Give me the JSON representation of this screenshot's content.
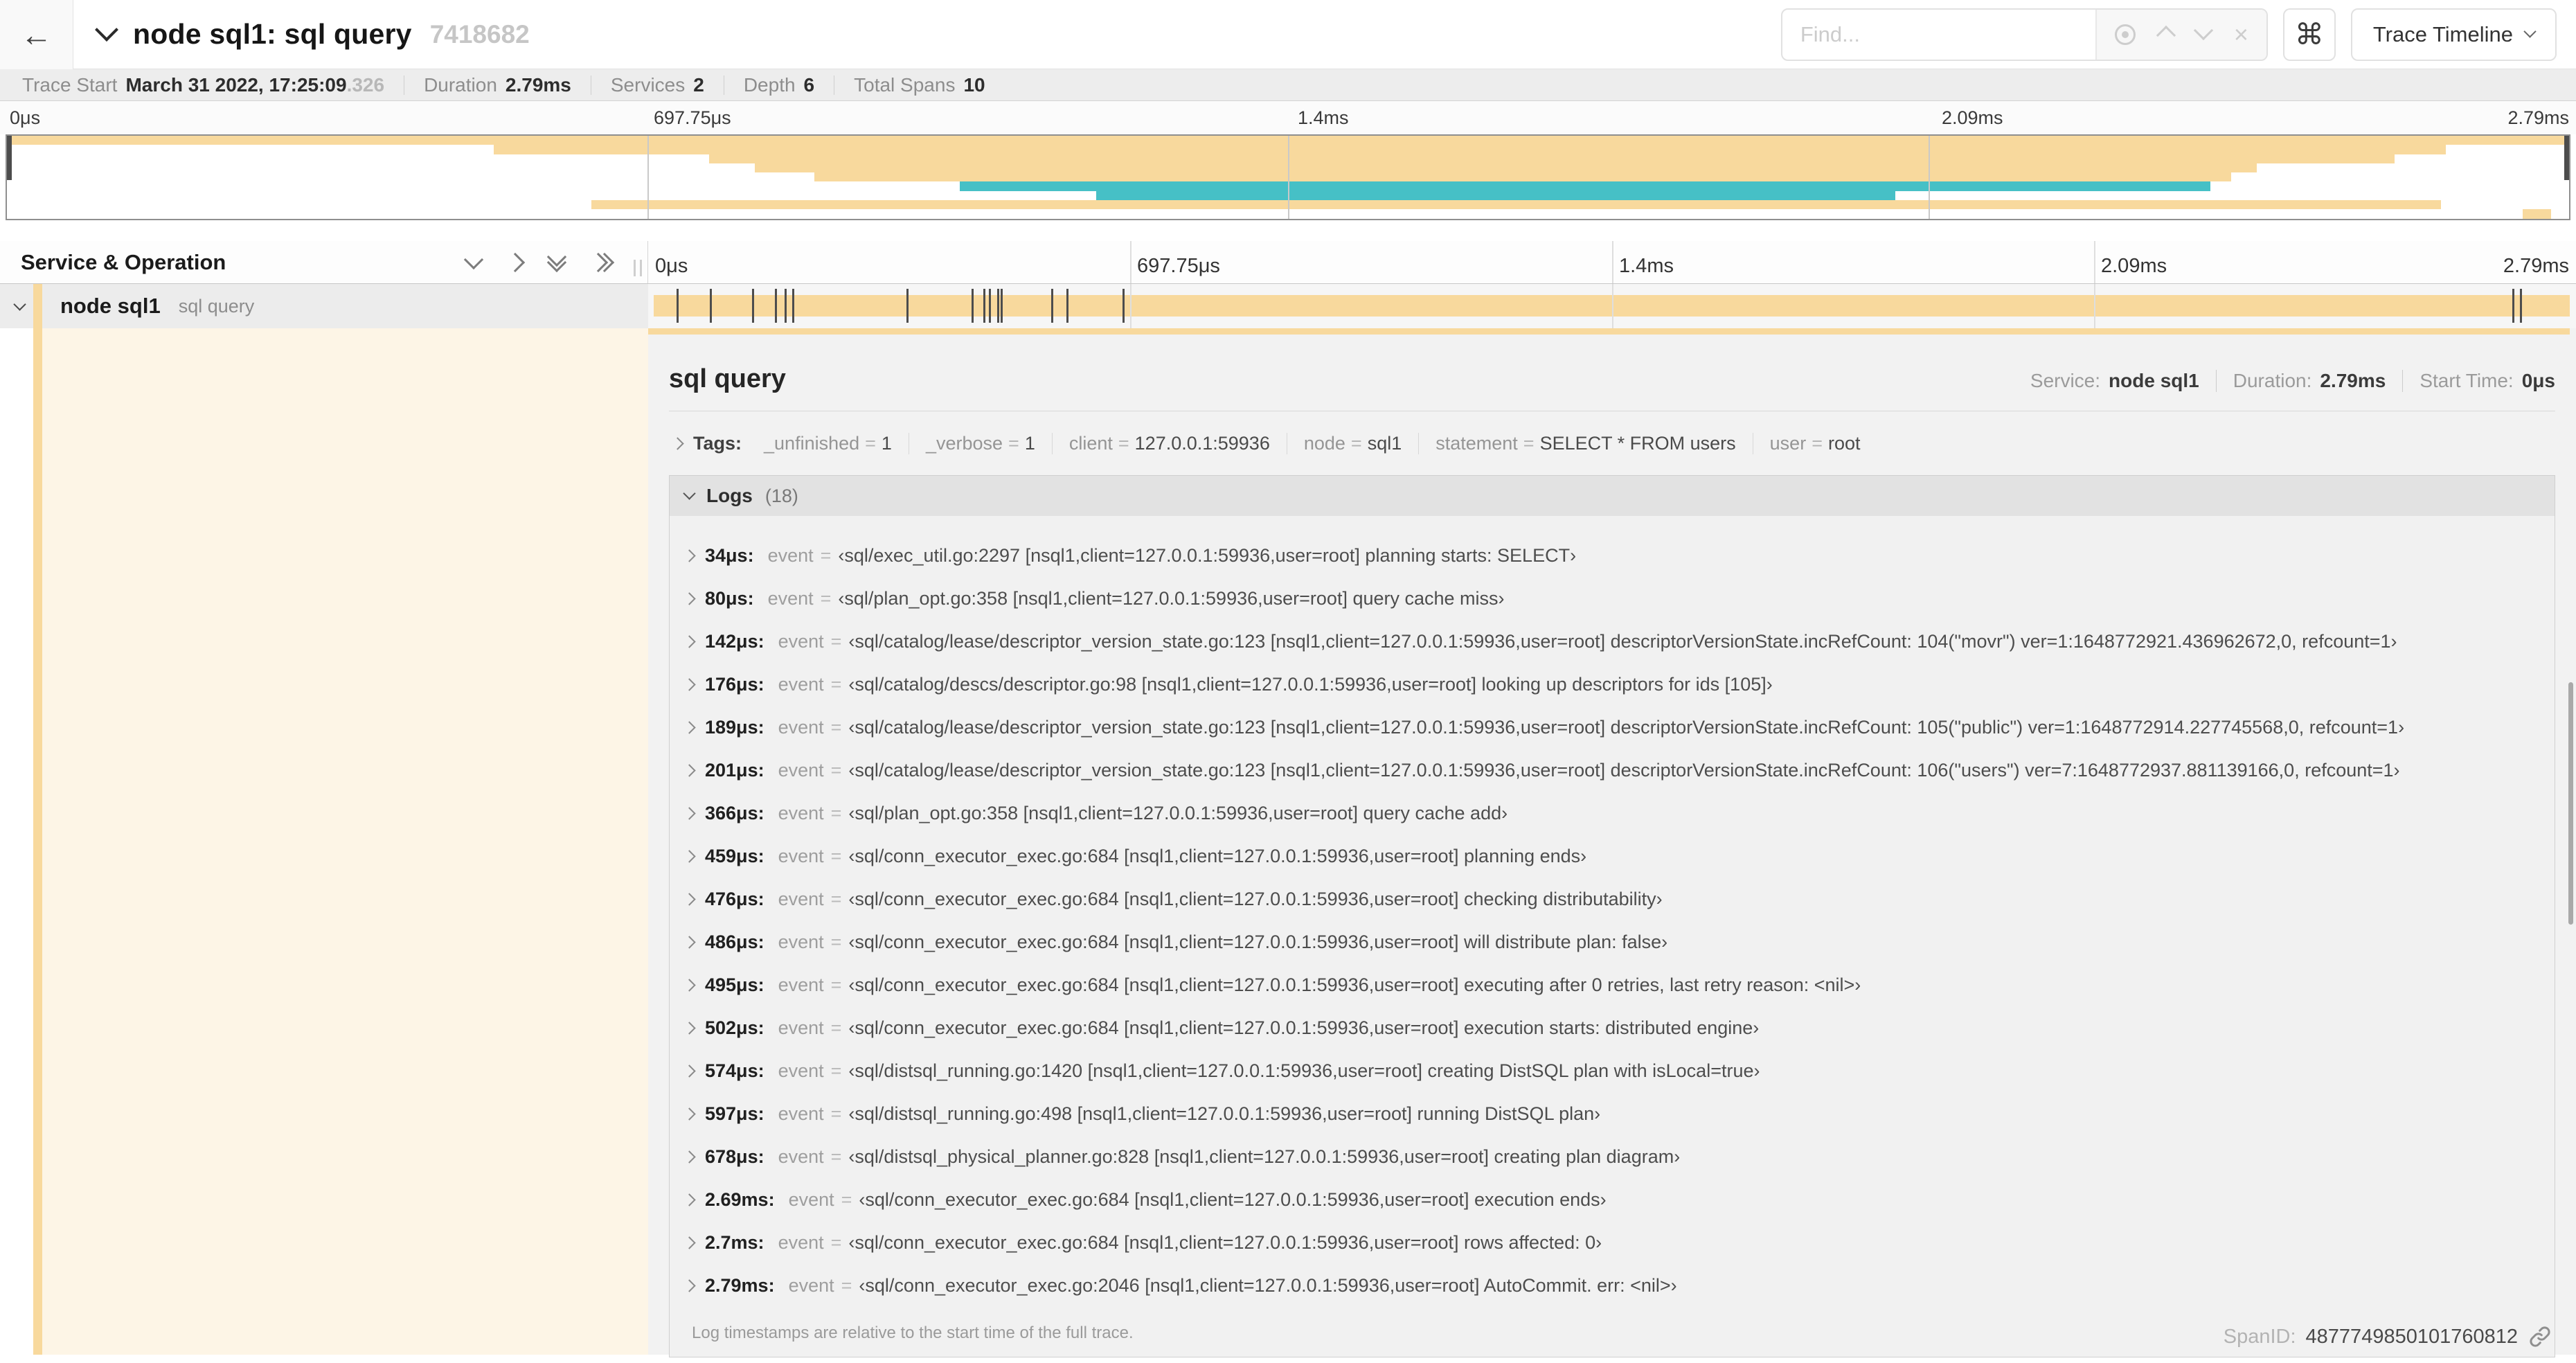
{
  "colors": {
    "tan": "#f8d99d",
    "cream": "#fdf5e6",
    "teal": "#46c0c6"
  },
  "topbar": {
    "back_icon": "←",
    "title": "node sql1: sql query",
    "trace_id": "7418682",
    "find_placeholder": "Find...",
    "shortcut_button": "⌘",
    "clear_icon": "×",
    "view_selector": "Trace Timeline"
  },
  "infobar": {
    "items": [
      {
        "label": "Trace Start",
        "value": "March 31 2022, 17:25:09",
        "suffix": ".326"
      },
      {
        "label": "Duration",
        "value": "2.79ms"
      },
      {
        "label": "Services",
        "value": "2"
      },
      {
        "label": "Depth",
        "value": "6"
      },
      {
        "label": "Total Spans",
        "value": "10"
      }
    ]
  },
  "timeline": {
    "tick_labels": [
      "0μs",
      "697.75μs",
      "1.4ms",
      "2.09ms",
      "2.79ms"
    ],
    "tick_pcts": [
      0,
      25,
      50,
      75,
      100
    ],
    "minimap_bars": [
      {
        "start": 0,
        "end": 100,
        "color": "tan"
      },
      {
        "start": 19.0,
        "end": 95.2,
        "color": "tan"
      },
      {
        "start": 27.4,
        "end": 93.2,
        "color": "tan"
      },
      {
        "start": 29.2,
        "end": 87.8,
        "color": "tan"
      },
      {
        "start": 31.5,
        "end": 86.8,
        "color": "tan"
      },
      {
        "start": 37.2,
        "end": 86.0,
        "color": "teal"
      },
      {
        "start": 42.5,
        "end": 73.7,
        "color": "teal"
      },
      {
        "start": 22.8,
        "end": 95.0,
        "color": "tan"
      },
      {
        "start": 98.2,
        "end": 99.3,
        "color": "tan"
      }
    ]
  },
  "grid": {
    "left_header": "Service & Operation"
  },
  "span_row": {
    "service": "node sql1",
    "operation": "sql query",
    "log_tick_pcts": [
      1.2,
      2.9,
      5.1,
      6.3,
      6.8,
      7.2,
      13.1,
      16.5,
      17.1,
      17.4,
      17.8,
      18.0,
      20.6,
      21.4,
      24.3,
      96.4,
      96.8,
      99.7
    ]
  },
  "detail": {
    "title": "sql query",
    "meta": [
      {
        "label": "Service:",
        "value": "node sql1"
      },
      {
        "label": "Duration:",
        "value": "2.79ms"
      },
      {
        "label": "Start Time:",
        "value": "0μs"
      }
    ],
    "tags_label": "Tags:",
    "tags": [
      {
        "key": "_unfinished",
        "value": "1"
      },
      {
        "key": "_verbose",
        "value": "1"
      },
      {
        "key": "client",
        "value": "127.0.0.1:59936"
      },
      {
        "key": "node",
        "value": "sql1"
      },
      {
        "key": "statement",
        "value": "SELECT * FROM users"
      },
      {
        "key": "user",
        "value": "root"
      }
    ],
    "logs_title": "Logs",
    "logs_count": "(18)",
    "log_field": "event",
    "logs": [
      {
        "time": "34μs:",
        "msg": "‹sql/exec_util.go:2297 [nsql1,client=127.0.0.1:59936,user=root] planning starts: SELECT›"
      },
      {
        "time": "80μs:",
        "msg": "‹sql/plan_opt.go:358 [nsql1,client=127.0.0.1:59936,user=root] query cache miss›"
      },
      {
        "time": "142μs:",
        "msg": "‹sql/catalog/lease/descriptor_version_state.go:123 [nsql1,client=127.0.0.1:59936,user=root] descriptorVersionState.incRefCount: 104(\"movr\") ver=1:1648772921.436962672,0, refcount=1›"
      },
      {
        "time": "176μs:",
        "msg": "‹sql/catalog/descs/descriptor.go:98 [nsql1,client=127.0.0.1:59936,user=root] looking up descriptors for ids [105]›"
      },
      {
        "time": "189μs:",
        "msg": "‹sql/catalog/lease/descriptor_version_state.go:123 [nsql1,client=127.0.0.1:59936,user=root] descriptorVersionState.incRefCount: 105(\"public\") ver=1:1648772914.227745568,0, refcount=1›"
      },
      {
        "time": "201μs:",
        "msg": "‹sql/catalog/lease/descriptor_version_state.go:123 [nsql1,client=127.0.0.1:59936,user=root] descriptorVersionState.incRefCount: 106(\"users\") ver=7:1648772937.881139166,0, refcount=1›"
      },
      {
        "time": "366μs:",
        "msg": "‹sql/plan_opt.go:358 [nsql1,client=127.0.0.1:59936,user=root] query cache add›"
      },
      {
        "time": "459μs:",
        "msg": "‹sql/conn_executor_exec.go:684 [nsql1,client=127.0.0.1:59936,user=root] planning ends›"
      },
      {
        "time": "476μs:",
        "msg": "‹sql/conn_executor_exec.go:684 [nsql1,client=127.0.0.1:59936,user=root] checking distributability›"
      },
      {
        "time": "486μs:",
        "msg": "‹sql/conn_executor_exec.go:684 [nsql1,client=127.0.0.1:59936,user=root] will distribute plan: false›"
      },
      {
        "time": "495μs:",
        "msg": "‹sql/conn_executor_exec.go:684 [nsql1,client=127.0.0.1:59936,user=root] executing after 0 retries, last retry reason: <nil>›"
      },
      {
        "time": "502μs:",
        "msg": "‹sql/conn_executor_exec.go:684 [nsql1,client=127.0.0.1:59936,user=root] execution starts: distributed engine›"
      },
      {
        "time": "574μs:",
        "msg": "‹sql/distsql_running.go:1420 [nsql1,client=127.0.0.1:59936,user=root] creating DistSQL plan with isLocal=true›"
      },
      {
        "time": "597μs:",
        "msg": "‹sql/distsql_running.go:498 [nsql1,client=127.0.0.1:59936,user=root] running DistSQL plan›"
      },
      {
        "time": "678μs:",
        "msg": "‹sql/distsql_physical_planner.go:828 [nsql1,client=127.0.0.1:59936,user=root] creating plan diagram›"
      },
      {
        "time": "2.69ms:",
        "msg": "‹sql/conn_executor_exec.go:684 [nsql1,client=127.0.0.1:59936,user=root] execution ends›"
      },
      {
        "time": "2.7ms:",
        "msg": "‹sql/conn_executor_exec.go:684 [nsql1,client=127.0.0.1:59936,user=root] rows affected: 0›"
      },
      {
        "time": "2.79ms:",
        "msg": "‹sql/conn_executor_exec.go:2046 [nsql1,client=127.0.0.1:59936,user=root] AutoCommit. err: <nil>›"
      }
    ],
    "logs_footnote": "Log timestamps are relative to the start time of the full trace.",
    "span_id_label": "SpanID:",
    "span_id": "4877749850101760812"
  }
}
